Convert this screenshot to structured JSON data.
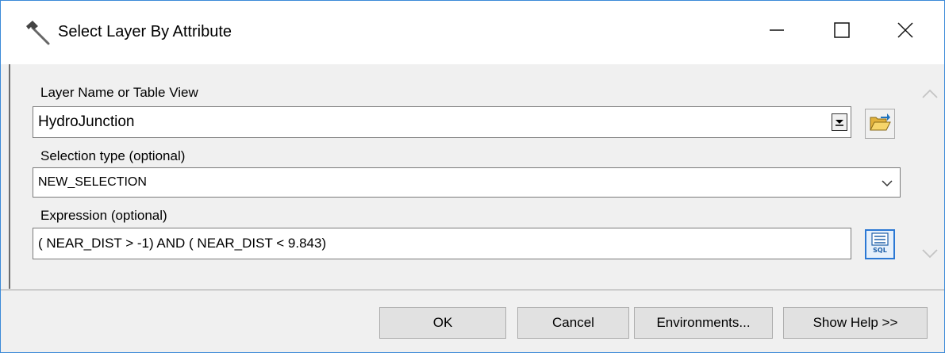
{
  "window": {
    "title": "Select Layer By Attribute",
    "app_icon": "hammer-icon",
    "controls": {
      "minimize_icon": "minimize-icon",
      "maximize_icon": "maximize-icon",
      "close_icon": "close-icon"
    }
  },
  "form": {
    "layer": {
      "label": "Layer Name or Table View",
      "value": "HydroJunction",
      "dropdown_icon": "dropdown-arrow-icon",
      "browse_icon": "open-folder-icon"
    },
    "selection_type": {
      "label": "Selection type (optional)",
      "value": "NEW_SELECTION",
      "dropdown_icon": "chevron-down-icon"
    },
    "expression": {
      "label": "Expression (optional)",
      "value": "( NEAR_DIST > -1) AND ( NEAR_DIST < 9.843)",
      "builder_icon": "sql-icon",
      "builder_text": "SQL"
    }
  },
  "scrollbar": {
    "up_icon": "chevron-up-icon",
    "down_icon": "chevron-down-icon"
  },
  "buttons": {
    "ok": "OK",
    "cancel": "Cancel",
    "environments": "Environments...",
    "show_help": "Show Help >>"
  },
  "colors": {
    "window_border": "#3b8ad8",
    "dialog_bg": "#f0f0f0",
    "button_bg": "#e1e1e1",
    "sql_accent": "#2b78d4"
  }
}
